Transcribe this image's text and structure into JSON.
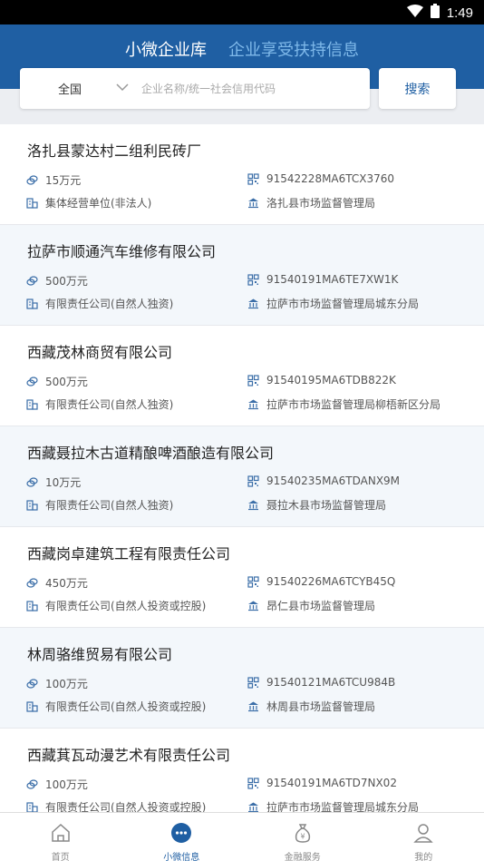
{
  "status_bar": {
    "time": "1:49"
  },
  "header": {
    "tabs": [
      {
        "label": "小微企业库",
        "active": true
      },
      {
        "label": "企业享受扶持信息",
        "active": false
      }
    ]
  },
  "search": {
    "region": "全国",
    "placeholder": "企业名称/统一社会信用代码",
    "button_label": "搜索"
  },
  "colors": {
    "brand": "#1f5fa3",
    "tab_inactive": "#7fb9ea",
    "icon": "#3b6ea8"
  },
  "companies": [
    {
      "name": "洛扎县蒙达村二组利民砖厂",
      "capital": "15万元",
      "code": "91542228MA6TCX3760",
      "type": "集体经营单位(非法人)",
      "authority": "洛扎县市场监督管理局"
    },
    {
      "name": "拉萨市顺通汽车维修有限公司",
      "capital": "500万元",
      "code": "91540191MA6TE7XW1K",
      "type": "有限责任公司(自然人独资)",
      "authority": "拉萨市市场监督管理局城东分局"
    },
    {
      "name": "西藏茂林商贸有限公司",
      "capital": "500万元",
      "code": "91540195MA6TDB822K",
      "type": "有限责任公司(自然人独资)",
      "authority": "拉萨市市场监督管理局柳梧新区分局"
    },
    {
      "name": "西藏聂拉木古道精酿啤酒酿造有限公司",
      "capital": "10万元",
      "code": "91540235MA6TDANX9M",
      "type": "有限责任公司(自然人独资)",
      "authority": "聂拉木县市场监督管理局"
    },
    {
      "name": "西藏岗卓建筑工程有限责任公司",
      "capital": "450万元",
      "code": "91540226MA6TCYB45Q",
      "type": "有限责任公司(自然人投资或控股)",
      "authority": "昂仁县市场监督管理局"
    },
    {
      "name": "林周骆维贸易有限公司",
      "capital": "100万元",
      "code": "91540121MA6TCU984B",
      "type": "有限责任公司(自然人投资或控股)",
      "authority": "林周县市场监督管理局"
    },
    {
      "name": "西藏萁瓦动漫艺术有限责任公司",
      "capital": "100万元",
      "code": "91540191MA6TD7NX02",
      "type": "有限责任公司(自然人投资或控股)",
      "authority": "拉萨市市场监督管理局城东分局"
    }
  ],
  "bottom_nav": [
    {
      "label": "首页",
      "icon": "home-icon",
      "active": false
    },
    {
      "label": "小微信息",
      "icon": "chat-dots-icon",
      "active": true
    },
    {
      "label": "金融服务",
      "icon": "money-bag-icon",
      "active": false
    },
    {
      "label": "我的",
      "icon": "person-icon",
      "active": false
    }
  ]
}
